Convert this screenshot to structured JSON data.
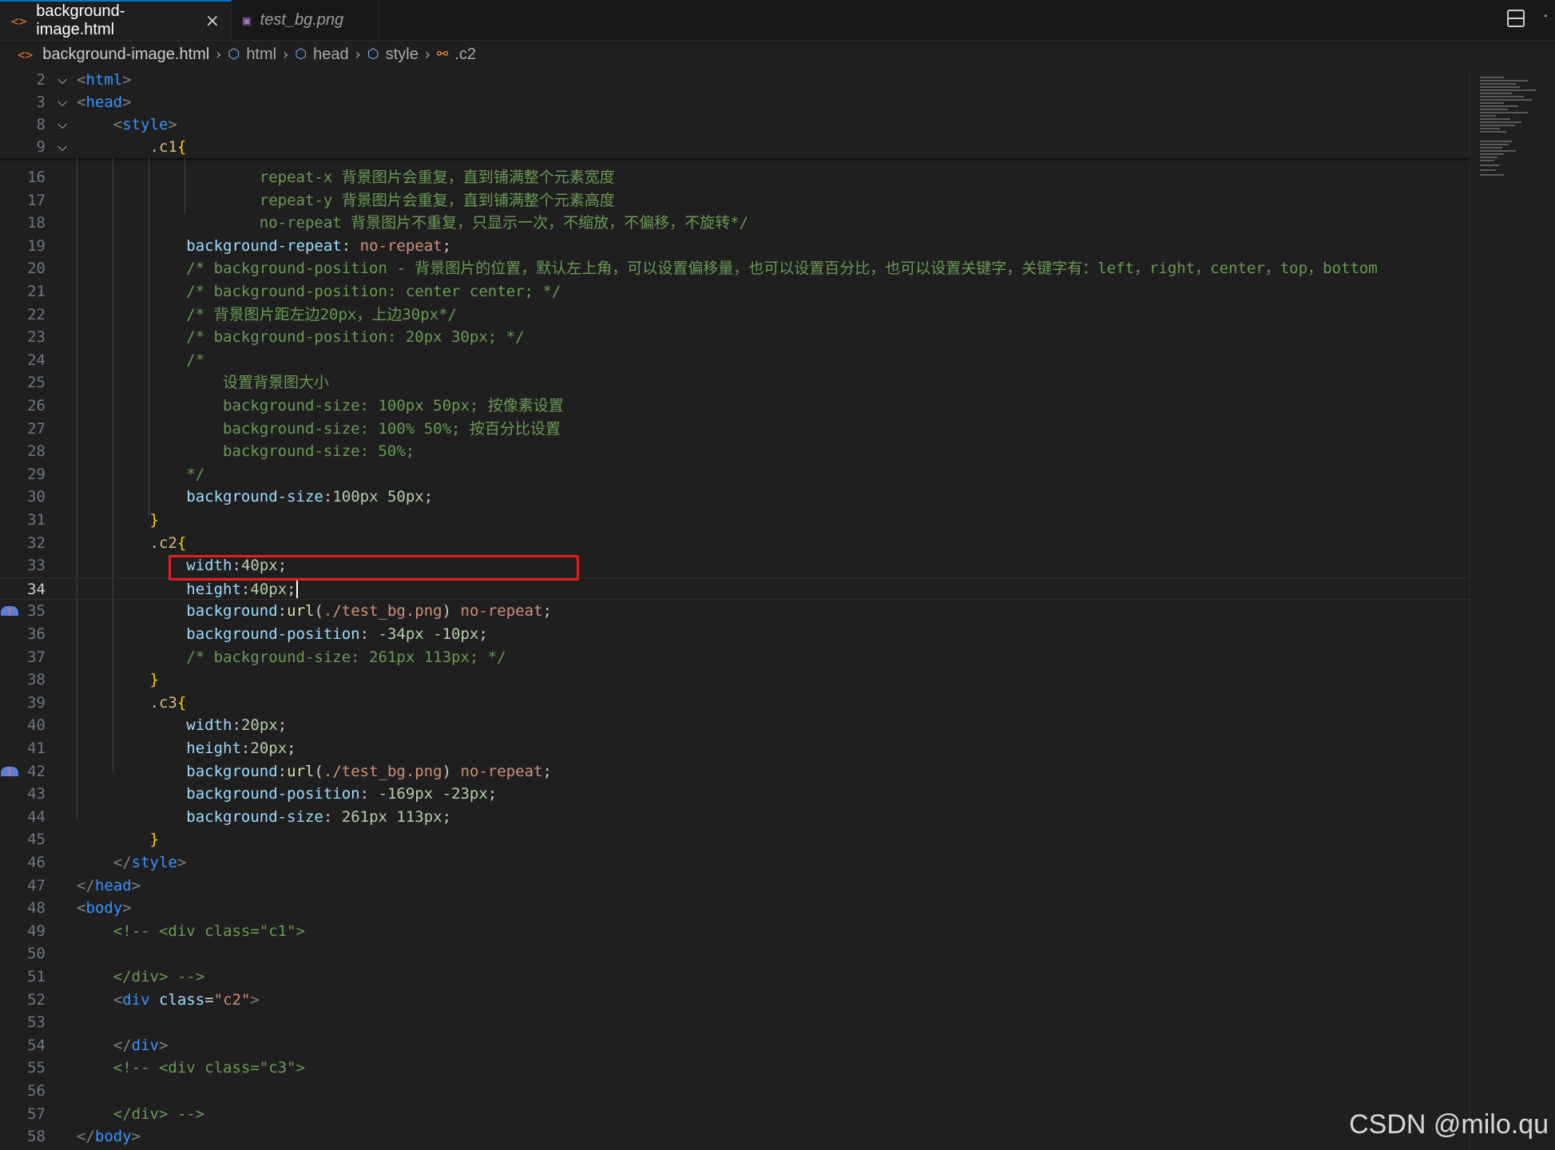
{
  "tabs": [
    {
      "label": "background-image.html",
      "icon": "html-file-icon",
      "active": true
    },
    {
      "label": "test_bg.png",
      "icon": "image-file-icon",
      "active": false
    }
  ],
  "breadcrumb": {
    "file": "background-image.html",
    "items": [
      "html",
      "head",
      "style",
      ".c2"
    ]
  },
  "editor": {
    "active_line": "34",
    "sticky_lines": [
      {
        "n": "2",
        "code": [
          [
            "br",
            "<"
          ],
          [
            "tag",
            "html"
          ],
          [
            "br",
            ">"
          ]
        ]
      },
      {
        "n": "3",
        "code": [
          [
            "br",
            "<"
          ],
          [
            "tag",
            "head"
          ],
          [
            "br",
            ">"
          ]
        ]
      },
      {
        "n": "8",
        "code": [
          [
            "plain",
            "    "
          ],
          [
            "br",
            "<"
          ],
          [
            "tag",
            "style"
          ],
          [
            "br",
            ">"
          ]
        ]
      },
      {
        "n": "9",
        "code": [
          [
            "plain",
            "        "
          ],
          [
            "sel",
            ".c1"
          ],
          [
            "brace",
            "{"
          ]
        ]
      }
    ],
    "lines": [
      {
        "n": "16",
        "code": [
          [
            "plain",
            "                    "
          ],
          [
            "cm",
            "repeat-x 背景图片会重复，直到铺满整个元素宽度"
          ]
        ]
      },
      {
        "n": "17",
        "code": [
          [
            "plain",
            "                    "
          ],
          [
            "cm",
            "repeat-y 背景图片会重复，直到铺满整个元素高度"
          ]
        ]
      },
      {
        "n": "18",
        "code": [
          [
            "plain",
            "                    "
          ],
          [
            "cm",
            "no-repeat 背景图片不重复，只显示一次，不缩放，不偏移，不旋转*/"
          ]
        ]
      },
      {
        "n": "19",
        "code": [
          [
            "plain",
            "            "
          ],
          [
            "prop",
            "background-repeat"
          ],
          [
            "plain",
            ": "
          ],
          [
            "val",
            "no-repeat"
          ],
          [
            "plain",
            ";"
          ]
        ]
      },
      {
        "n": "20",
        "code": [
          [
            "plain",
            "            "
          ],
          [
            "cm",
            "/* background-position - 背景图片的位置，默认左上角，可以设置偏移量，也可以设置百分比，也可以设置关键字，关键字有：left，right，center，top，bottom"
          ]
        ]
      },
      {
        "n": "21",
        "code": [
          [
            "plain",
            "            "
          ],
          [
            "cm",
            "/* background-position: center center; */"
          ]
        ]
      },
      {
        "n": "22",
        "code": [
          [
            "plain",
            "            "
          ],
          [
            "cm",
            "/* 背景图片距左边20px，上边30px*/"
          ]
        ]
      },
      {
        "n": "23",
        "code": [
          [
            "plain",
            "            "
          ],
          [
            "cm",
            "/* background-position: 20px 30px; */"
          ]
        ]
      },
      {
        "n": "24",
        "code": [
          [
            "plain",
            "            "
          ],
          [
            "cm",
            "/*"
          ]
        ]
      },
      {
        "n": "25",
        "code": [
          [
            "plain",
            "                "
          ],
          [
            "cm",
            "设置背景图大小"
          ]
        ]
      },
      {
        "n": "26",
        "code": [
          [
            "plain",
            "                "
          ],
          [
            "cm",
            "background-size: 100px 50px; 按像素设置"
          ]
        ]
      },
      {
        "n": "27",
        "code": [
          [
            "plain",
            "                "
          ],
          [
            "cm",
            "background-size: 100% 50%; 按百分比设置"
          ]
        ]
      },
      {
        "n": "28",
        "code": [
          [
            "plain",
            "                "
          ],
          [
            "cm",
            "background-size: 50%;"
          ]
        ]
      },
      {
        "n": "29",
        "code": [
          [
            "plain",
            "            "
          ],
          [
            "cm",
            "*/"
          ]
        ]
      },
      {
        "n": "30",
        "code": [
          [
            "plain",
            "            "
          ],
          [
            "prop",
            "background-size"
          ],
          [
            "plain",
            ":"
          ],
          [
            "num",
            "100px 50px"
          ],
          [
            "plain",
            ";"
          ]
        ]
      },
      {
        "n": "31",
        "code": [
          [
            "plain",
            "        "
          ],
          [
            "brace",
            "}"
          ]
        ]
      },
      {
        "n": "32",
        "code": [
          [
            "plain",
            "        "
          ],
          [
            "sel",
            ".c2"
          ],
          [
            "brace",
            "{"
          ]
        ]
      },
      {
        "n": "33",
        "code": [
          [
            "plain",
            "            "
          ],
          [
            "prop",
            "width"
          ],
          [
            "plain",
            ":"
          ],
          [
            "num",
            "40px"
          ],
          [
            "plain",
            ";"
          ]
        ]
      },
      {
        "n": "34",
        "code": [
          [
            "plain",
            "            "
          ],
          [
            "prop",
            "height"
          ],
          [
            "plain",
            ":"
          ],
          [
            "num",
            "40px"
          ],
          [
            "plain",
            ";"
          ]
        ]
      },
      {
        "n": "35",
        "code": [
          [
            "plain",
            "            "
          ],
          [
            "prop",
            "background"
          ],
          [
            "plain",
            ":"
          ],
          [
            "fn",
            "url"
          ],
          [
            "plain",
            "("
          ],
          [
            "val",
            "./test_bg.png"
          ],
          [
            "plain",
            ") "
          ],
          [
            "val",
            "no-repeat"
          ],
          [
            "plain",
            ";"
          ]
        ]
      },
      {
        "n": "36",
        "code": [
          [
            "plain",
            "            "
          ],
          [
            "prop",
            "background-position"
          ],
          [
            "plain",
            ": "
          ],
          [
            "num",
            "-34px -10px"
          ],
          [
            "plain",
            ";"
          ]
        ]
      },
      {
        "n": "37",
        "code": [
          [
            "plain",
            "            "
          ],
          [
            "cm",
            "/* background-size: 261px 113px; */"
          ]
        ]
      },
      {
        "n": "38",
        "code": [
          [
            "plain",
            "        "
          ],
          [
            "brace",
            "}"
          ]
        ]
      },
      {
        "n": "39",
        "code": [
          [
            "plain",
            "        "
          ],
          [
            "sel",
            ".c3"
          ],
          [
            "brace",
            "{"
          ]
        ]
      },
      {
        "n": "40",
        "code": [
          [
            "plain",
            "            "
          ],
          [
            "prop",
            "width"
          ],
          [
            "plain",
            ":"
          ],
          [
            "num",
            "20px"
          ],
          [
            "plain",
            ";"
          ]
        ]
      },
      {
        "n": "41",
        "code": [
          [
            "plain",
            "            "
          ],
          [
            "prop",
            "height"
          ],
          [
            "plain",
            ":"
          ],
          [
            "num",
            "20px"
          ],
          [
            "plain",
            ";"
          ]
        ]
      },
      {
        "n": "42",
        "code": [
          [
            "plain",
            "            "
          ],
          [
            "prop",
            "background"
          ],
          [
            "plain",
            ":"
          ],
          [
            "fn",
            "url"
          ],
          [
            "plain",
            "("
          ],
          [
            "val",
            "./test_bg.png"
          ],
          [
            "plain",
            ") "
          ],
          [
            "val",
            "no-repeat"
          ],
          [
            "plain",
            ";"
          ]
        ]
      },
      {
        "n": "43",
        "code": [
          [
            "plain",
            "            "
          ],
          [
            "prop",
            "background-position"
          ],
          [
            "plain",
            ": "
          ],
          [
            "num",
            "-169px -23px"
          ],
          [
            "plain",
            ";"
          ]
        ]
      },
      {
        "n": "44",
        "code": [
          [
            "plain",
            "            "
          ],
          [
            "prop",
            "background-size"
          ],
          [
            "plain",
            ": "
          ],
          [
            "num",
            "261px 113px"
          ],
          [
            "plain",
            ";"
          ]
        ]
      },
      {
        "n": "45",
        "code": [
          [
            "plain",
            "        "
          ],
          [
            "brace",
            "}"
          ]
        ]
      },
      {
        "n": "46",
        "code": [
          [
            "plain",
            "    "
          ],
          [
            "br",
            "</"
          ],
          [
            "tag",
            "style"
          ],
          [
            "br",
            ">"
          ]
        ]
      },
      {
        "n": "47",
        "code": [
          [
            "br",
            "</"
          ],
          [
            "tag",
            "head"
          ],
          [
            "br",
            ">"
          ]
        ]
      },
      {
        "n": "48",
        "code": [
          [
            "br",
            "<"
          ],
          [
            "tag",
            "body"
          ],
          [
            "br",
            ">"
          ]
        ]
      },
      {
        "n": "49",
        "code": [
          [
            "plain",
            "    "
          ],
          [
            "cm",
            "<!-- <div class=\"c1\">"
          ]
        ]
      },
      {
        "n": "50",
        "code": []
      },
      {
        "n": "51",
        "code": [
          [
            "plain",
            "    "
          ],
          [
            "cm",
            "</div> -->"
          ]
        ]
      },
      {
        "n": "52",
        "code": [
          [
            "plain",
            "    "
          ],
          [
            "br",
            "<"
          ],
          [
            "tag",
            "div"
          ],
          [
            "plain",
            " "
          ],
          [
            "attr",
            "class"
          ],
          [
            "plain",
            "="
          ],
          [
            "val",
            "\"c2\""
          ],
          [
            "br",
            ">"
          ]
        ]
      },
      {
        "n": "53",
        "code": []
      },
      {
        "n": "54",
        "code": [
          [
            "plain",
            "    "
          ],
          [
            "br",
            "</"
          ],
          [
            "tag",
            "div"
          ],
          [
            "br",
            ">"
          ]
        ]
      },
      {
        "n": "55",
        "code": [
          [
            "plain",
            "    "
          ],
          [
            "cm",
            "<!-- <div class=\"c3\">"
          ]
        ]
      },
      {
        "n": "56",
        "code": []
      },
      {
        "n": "57",
        "code": [
          [
            "plain",
            "    "
          ],
          [
            "cm",
            "</div> -->"
          ]
        ]
      },
      {
        "n": "58",
        "code": [
          [
            "br",
            "</"
          ],
          [
            "tag",
            "body"
          ],
          [
            "br",
            ">"
          ]
        ]
      }
    ]
  },
  "watermark": "CSDN @milo.qu"
}
